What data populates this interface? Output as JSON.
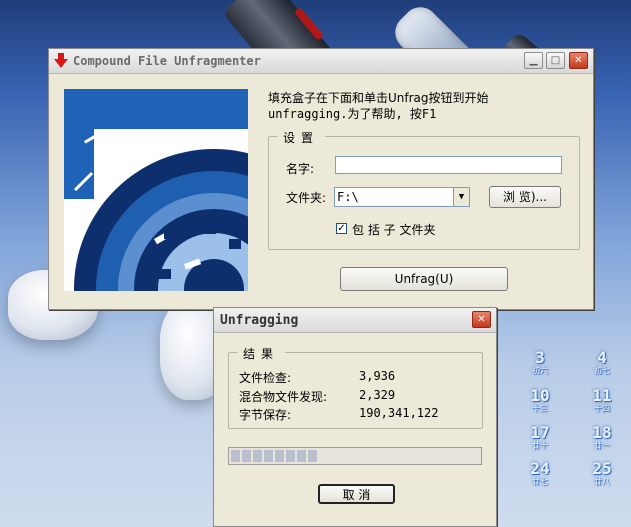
{
  "main_window": {
    "title": "Compound File Unfragmenter",
    "instructions_line1": "填充盒子在下面和单击Unfrag按钮到开始",
    "instructions_line2": "unfragging.为了帮助, 按F1",
    "settings_group": "设置",
    "name_label": "名字:",
    "name_value": "",
    "folder_label": "文件夹:",
    "folder_value": "F:\\",
    "browse_label": "浏 览)...",
    "include_subfolders_label": "包 括 子 文件夹",
    "include_subfolders_checked": true,
    "unfrag_button_label": "Unfrag(U)"
  },
  "progress_dialog": {
    "title": "Unfragging",
    "results_group": "结果",
    "rows": [
      {
        "label": "文件检查:",
        "value": "3,936"
      },
      {
        "label": "混合物文件发现:",
        "value": "2,329"
      },
      {
        "label": "字节保存:",
        "value": "190,341,122"
      }
    ],
    "progress_fraction": 0.35,
    "cancel_label": "取 消"
  },
  "desktop_calendar": [
    {
      "day": "3",
      "lunar": "初六"
    },
    {
      "day": "4",
      "lunar": "初七"
    },
    {
      "day": "10",
      "lunar": "十三"
    },
    {
      "day": "11",
      "lunar": "十四"
    },
    {
      "day": "17",
      "lunar": "廿十"
    },
    {
      "day": "18",
      "lunar": "廿一"
    },
    {
      "day": "24",
      "lunar": "廿七"
    },
    {
      "day": "25",
      "lunar": "廿八"
    }
  ],
  "colors": {
    "window_bg": "#ece9d8",
    "close_button": "#c33a1d",
    "graphic_blue": "#1e63b8"
  }
}
